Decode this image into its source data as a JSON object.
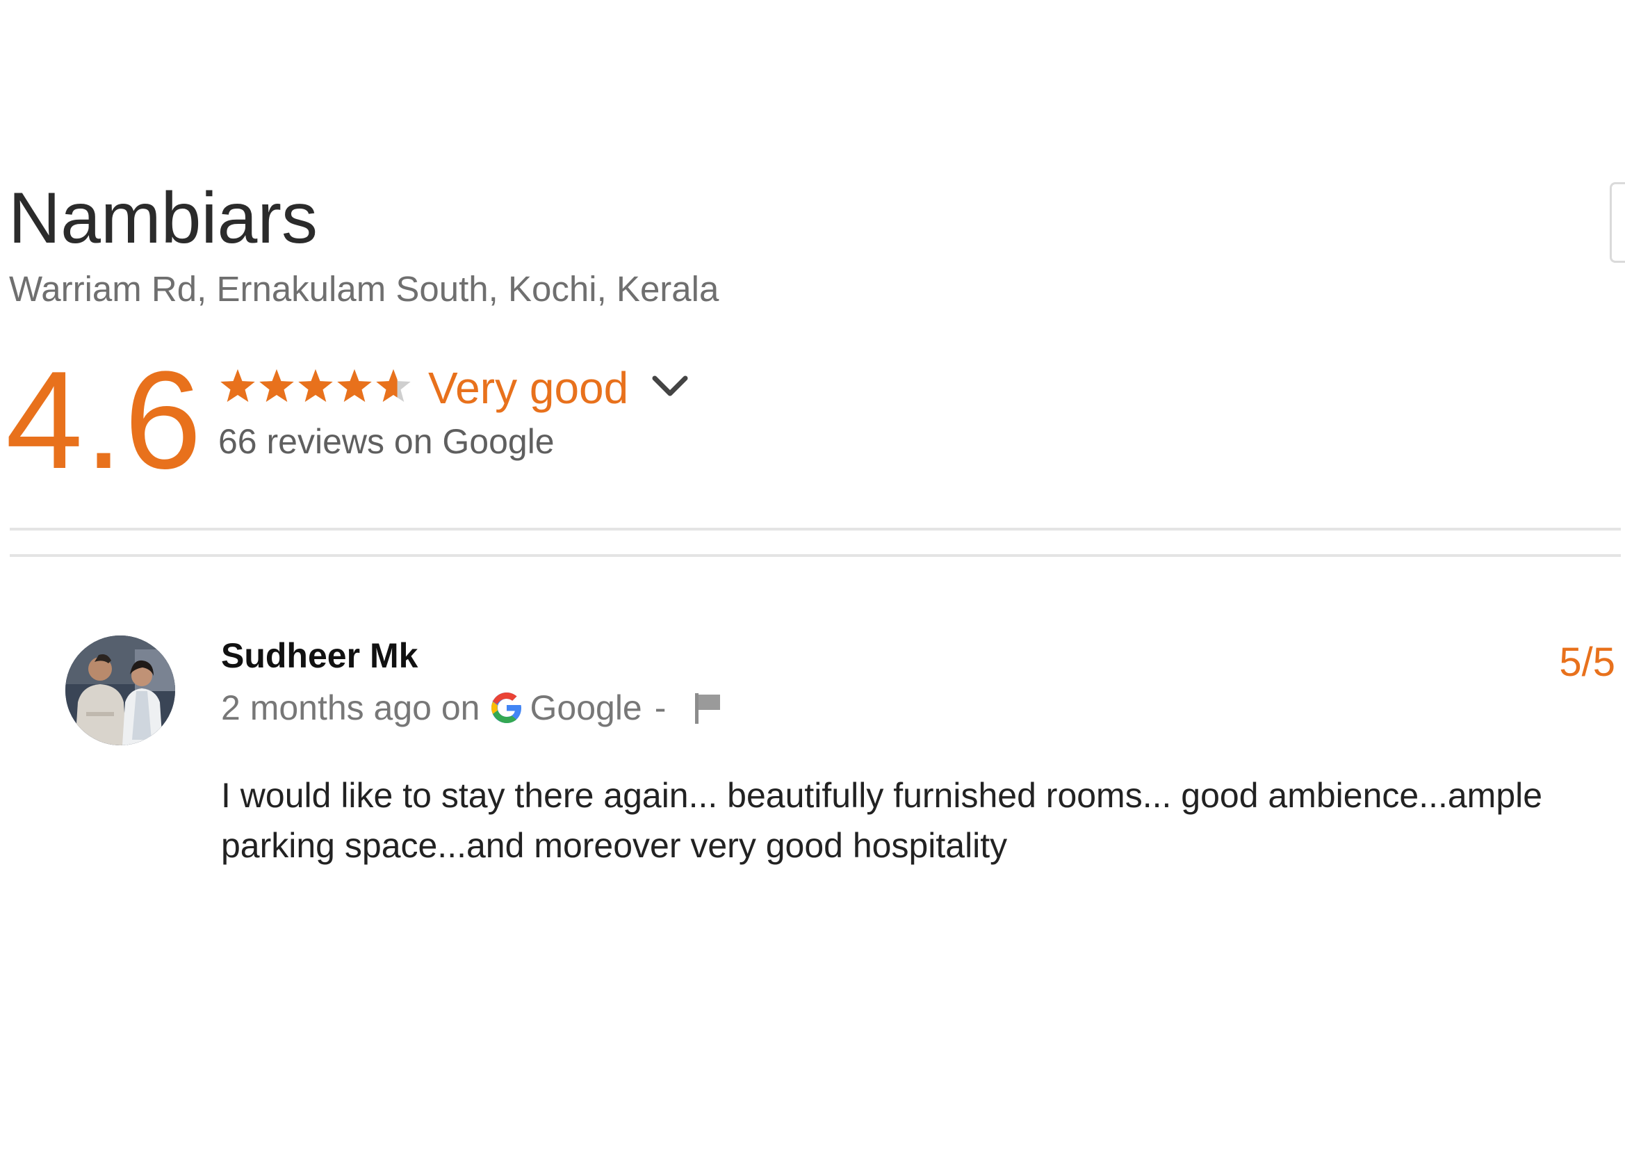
{
  "place": {
    "name": "Nambiars",
    "address": "Warriam Rd, Ernakulam South, Kochi, Kerala"
  },
  "rating": {
    "score": "4.6",
    "score_value": 4.6,
    "score_max": 5,
    "stars_filled_fraction": 0.92,
    "label": "Very good",
    "reviews_text": "66 reviews on Google",
    "expand_icon": "chevron-down-icon"
  },
  "review": {
    "author": "Sudheer Mk",
    "time": "2 months ago on",
    "source": "Google",
    "separator": "-",
    "score": "5/5",
    "text": "I would like to stay there again... beautifully furnished rooms... good ambience...ample parking space...and moreover very good hospitality",
    "flag_icon": "flag-icon",
    "source_icon": "google-g-icon"
  },
  "colors": {
    "accent": "#e8711c",
    "star_empty": "#cfcfcf",
    "divider": "#e4e4e4",
    "muted_text": "#777777"
  }
}
